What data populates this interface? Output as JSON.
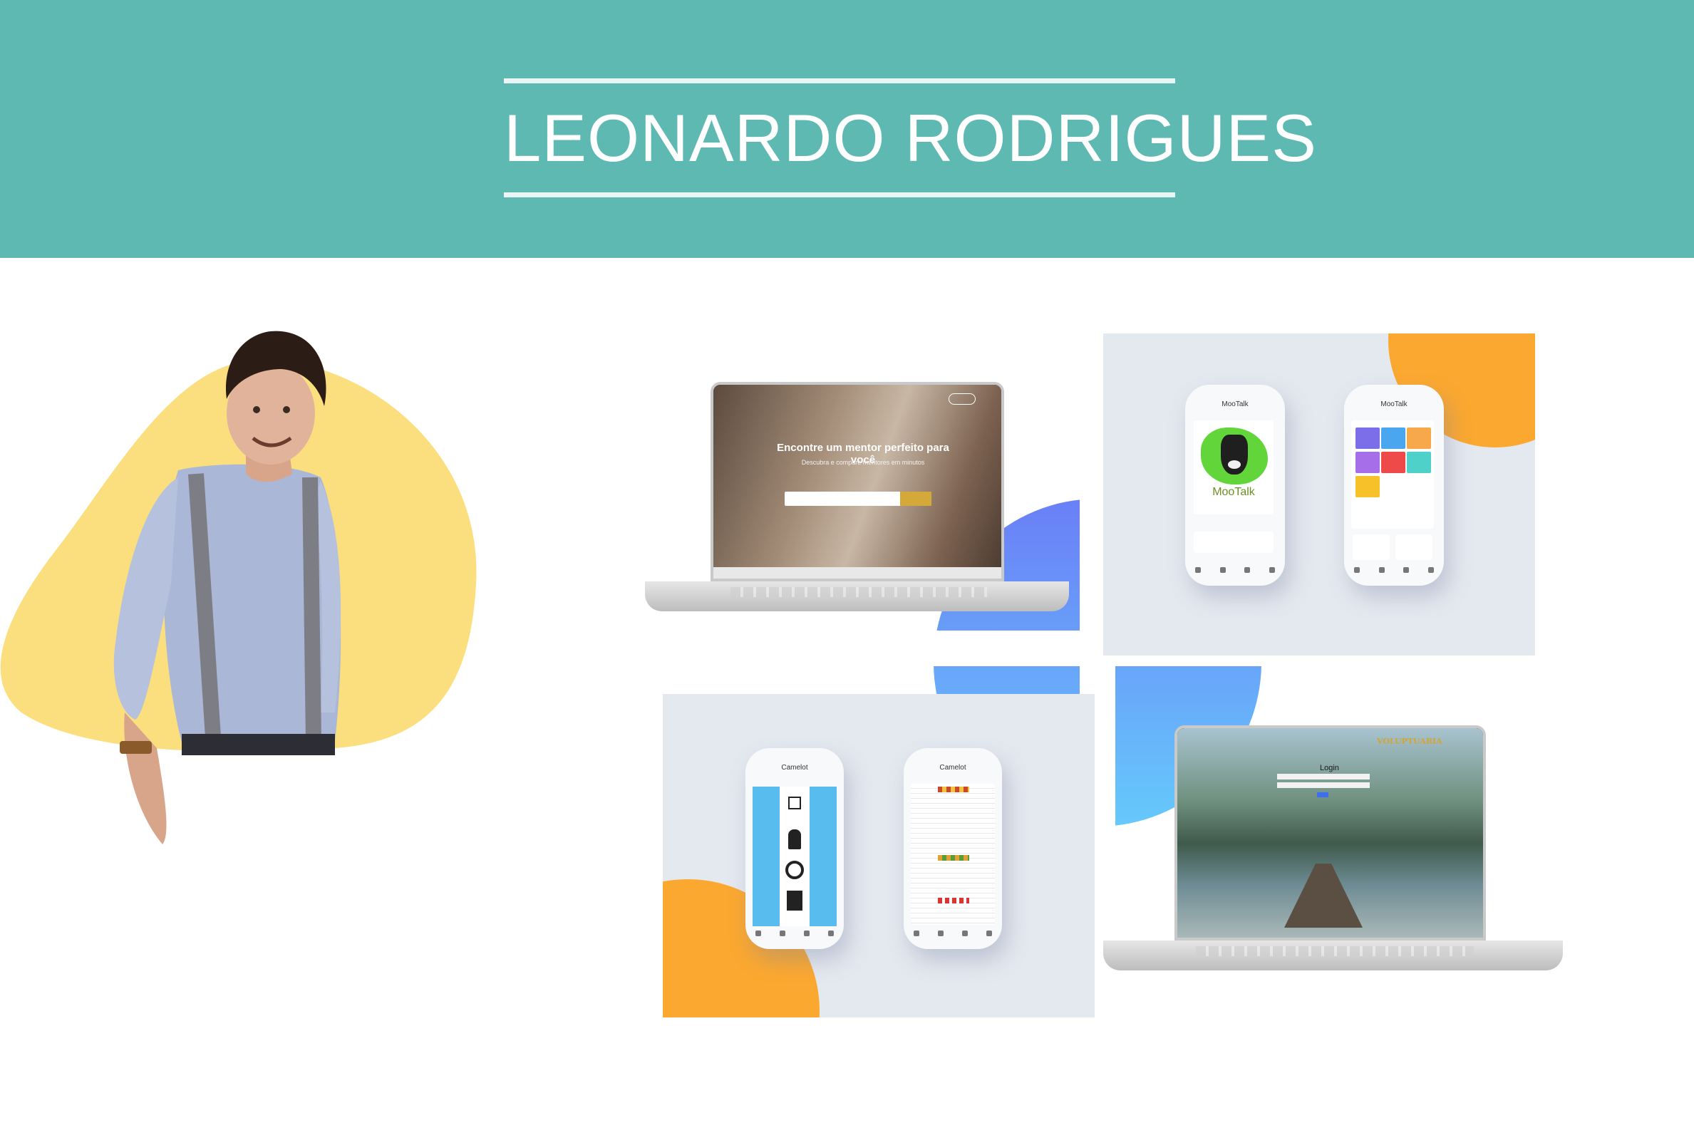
{
  "header": {
    "name": "LEONARDO RODRIGUES"
  },
  "mentor_site": {
    "headline": "Encontre um mentor perfeito para você",
    "subheadline": "Descubra e compare mentores em minutos"
  },
  "mootalk": {
    "title": "MooTalk",
    "logo_text": "MooTalk"
  },
  "camelot": {
    "title": "Camelot"
  },
  "voluptuaria": {
    "brand": "VOLUPTUARIA",
    "login_title": "Login"
  },
  "colors": {
    "header": "#5db9b1",
    "blob_yellow": "#fbdf7e",
    "blue_accent": "#6a86f8",
    "orange_accent": "#fba830",
    "panel_gray": "#e4e8ef"
  },
  "icons": [
    "person-photo",
    "laptop-mockup",
    "phone-mockup",
    "cow-logo-icon"
  ]
}
